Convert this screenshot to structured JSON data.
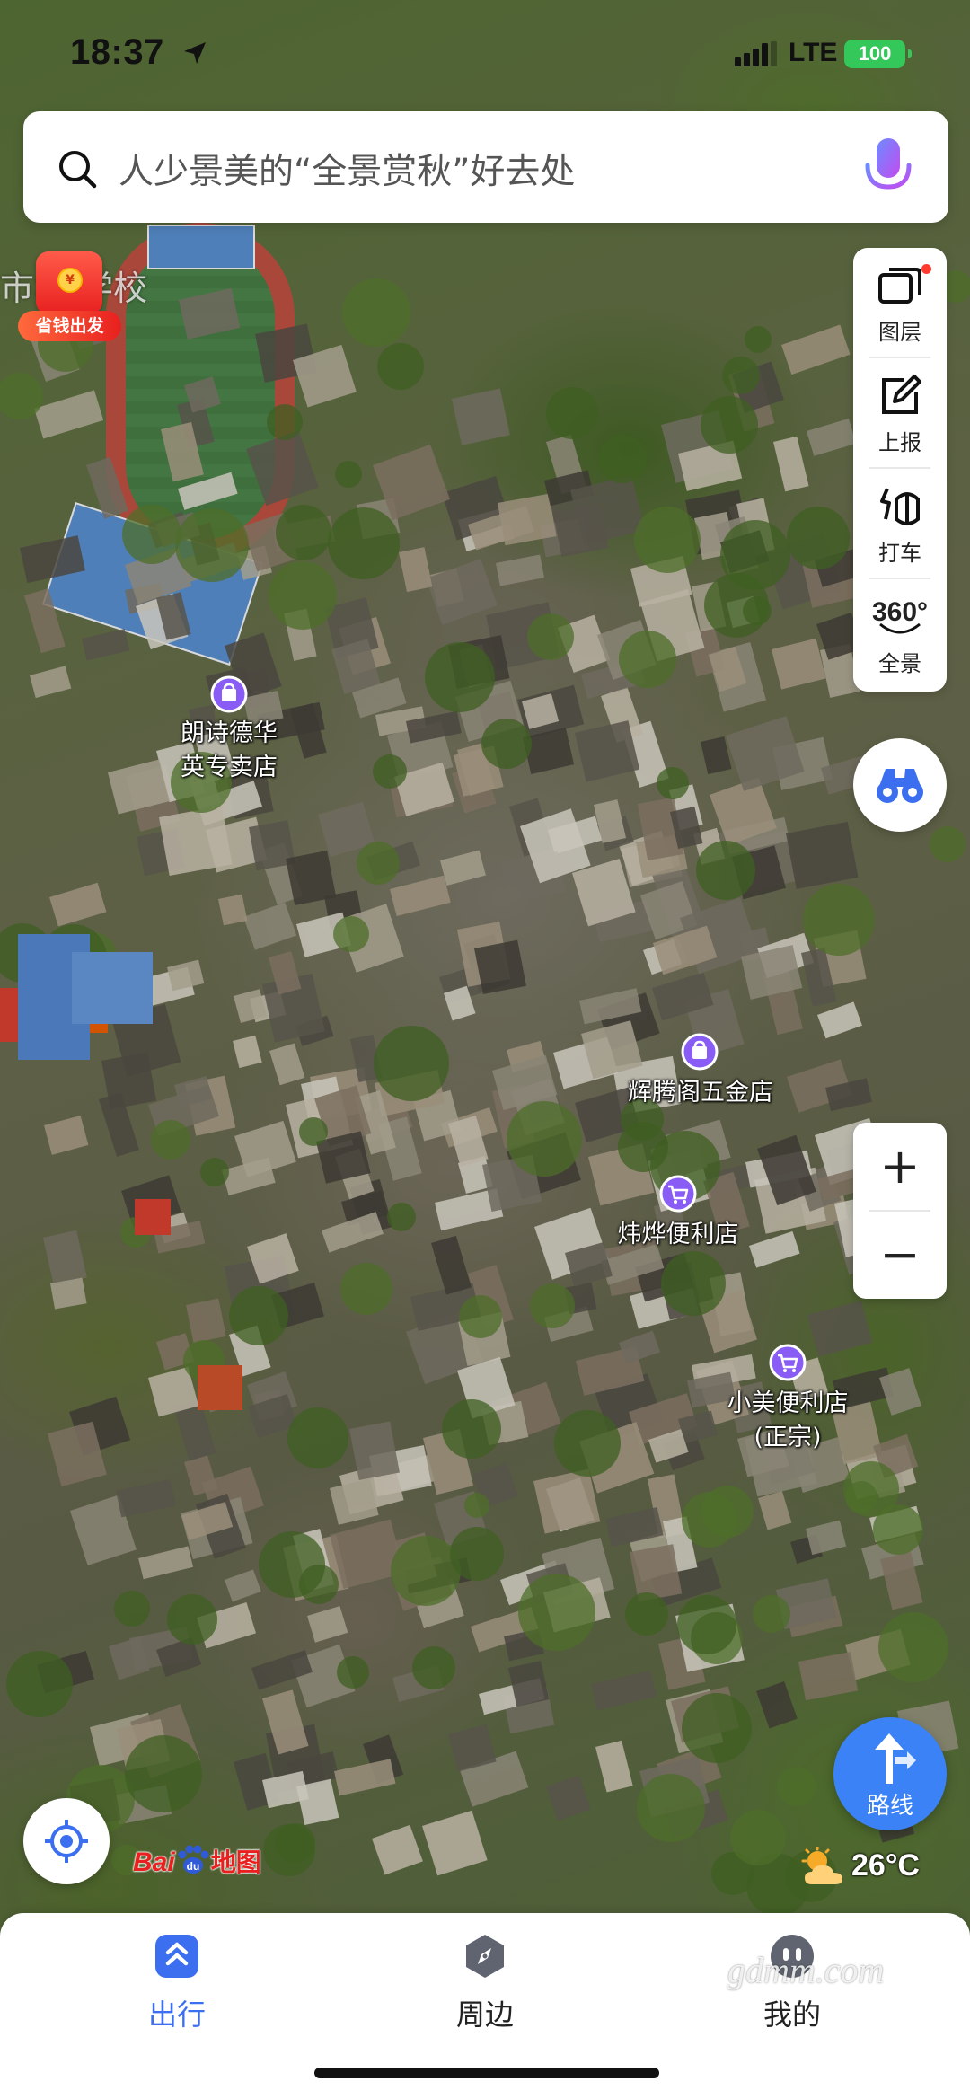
{
  "status_bar": {
    "time": "18:37",
    "network": "LTE",
    "battery": "100"
  },
  "search": {
    "placeholder": "人少景美的“全景赏秋”好去处"
  },
  "promo": {
    "label": "省钱出发",
    "map_label": "市华 学校"
  },
  "toolbar": {
    "layers": "图层",
    "report": "上报",
    "taxi": "打车",
    "panorama_number": "360°",
    "panorama": "全景"
  },
  "zoom": {
    "in": "+",
    "out": "−"
  },
  "pois": [
    {
      "line1": "朗诗德华",
      "line2": "英专卖店",
      "icon": "shop-bag-icon"
    },
    {
      "line1": "辉腾阁五金店",
      "line2": "",
      "icon": "shop-bag-icon"
    },
    {
      "line1": "炜烨便利店",
      "line2": "",
      "icon": "shopping-cart-icon"
    },
    {
      "line1": "小美便利店",
      "line2": "(正宗)",
      "icon": "shopping-cart-icon"
    }
  ],
  "route": {
    "label": "路线"
  },
  "logo": {
    "brand_latin": "Bai",
    "brand_du": "du",
    "brand_cn": "地图"
  },
  "weather": {
    "temp": "26°C",
    "icon": "sun-cloud-icon"
  },
  "tabs": [
    {
      "label": "出行",
      "icon": "travel-icon",
      "active": true
    },
    {
      "label": "周边",
      "icon": "compass-icon",
      "active": false
    },
    {
      "label": "我的",
      "icon": "profile-icon",
      "active": false
    }
  ],
  "watermark": "gdmm.com",
  "colors": {
    "accent": "#3b82f6",
    "poi": "#8a5cf6",
    "promo": "#e8201f"
  }
}
